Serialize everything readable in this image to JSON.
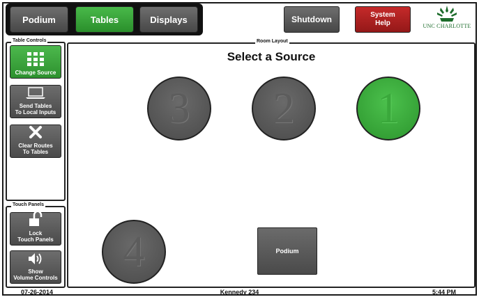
{
  "top_nav": {
    "tabs": [
      {
        "label": "Podium",
        "state": "inactive"
      },
      {
        "label": "Tables",
        "state": "active"
      },
      {
        "label": "Displays",
        "state": "inactive"
      }
    ],
    "shutdown_label": "Shutdown",
    "help_line1": "System",
    "help_line2": "Help",
    "logo_text": "UNC CHARLOTTE"
  },
  "table_controls": {
    "panel_label": "Table Controls",
    "buttons": [
      {
        "line1": "Change Source",
        "line2": "",
        "icon": "grid-icon",
        "active": true
      },
      {
        "line1": "Send Tables",
        "line2": "To Local Inputs",
        "icon": "laptop-icon",
        "active": false
      },
      {
        "line1": "Clear Routes",
        "line2": "To Tables",
        "icon": "close-icon",
        "active": false
      }
    ]
  },
  "touch_panels": {
    "panel_label": "Touch Panels",
    "buttons": [
      {
        "line1": "Lock",
        "line2": "Touch Panels",
        "icon": "lock-icon"
      },
      {
        "line1": "Show",
        "line2": "Volume Controls",
        "icon": "speaker-icon"
      }
    ]
  },
  "room_layout": {
    "panel_label": "Room Layout",
    "title": "Select a Source",
    "tables": [
      {
        "number": "3",
        "selected": false
      },
      {
        "number": "2",
        "selected": false
      },
      {
        "number": "1",
        "selected": true
      },
      {
        "number": "4",
        "selected": false
      }
    ],
    "podium_label": "Podium"
  },
  "footer": {
    "date": "07-26-2014",
    "room": "Kennedy 234",
    "time": "5:44 PM"
  },
  "colors": {
    "accent_green": "#2d912e",
    "help_red": "#941818",
    "button_gray": "#4a4a4a"
  }
}
